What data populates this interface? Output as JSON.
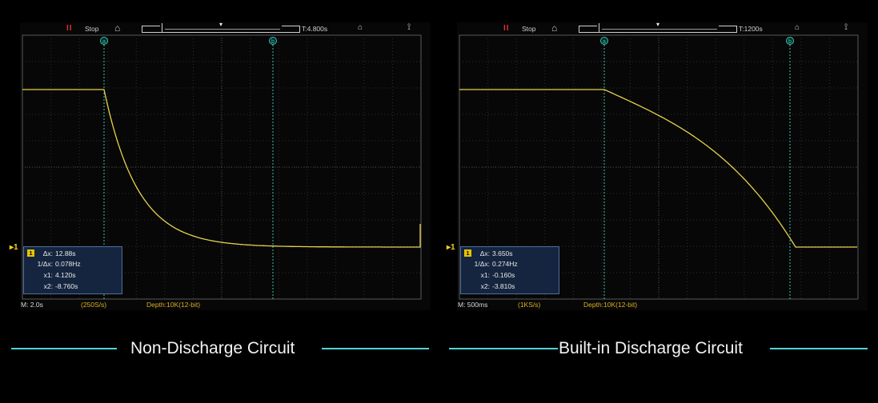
{
  "panels": [
    {
      "id": "left",
      "status": {
        "run_icon": "pause-icon",
        "run_glyph": "II",
        "text": "Stop"
      },
      "trigger_time": "T:4.800s",
      "cursor_labels": {
        "a": "a",
        "b": "b"
      },
      "channel_badge": "1",
      "trigger_marker": "1",
      "measurements": {
        "dx": "12.88s",
        "inv_dx": "0.078Hz",
        "x1": "4.120s",
        "x2": "-8.760s"
      },
      "timebase": "M: 2.0s",
      "sample_rate": "(250S/s)",
      "depth": "Depth:10K(12-bit)",
      "caption": "Non-Discharge Circuit"
    },
    {
      "id": "right",
      "status": {
        "run_icon": "pause-icon",
        "run_glyph": "II",
        "text": "Stop"
      },
      "trigger_time": "T:1200s",
      "cursor_labels": {
        "a": "a",
        "b": "b"
      },
      "channel_badge": "1",
      "trigger_marker": "1",
      "measurements": {
        "dx": "3.650s",
        "inv_dx": "0.274Hz",
        "x1": "-0.160s",
        "x2": "-3.810s"
      },
      "timebase": "M: 500ms",
      "sample_rate": "(1KS/s)",
      "depth": "Depth:10K(12-bit)",
      "caption": "Built-in Discharge Circuit"
    }
  ],
  "labels": {
    "dx": "Δx:",
    "inv_dx": "1/Δx:",
    "x1": "x1:",
    "x2": "x2:"
  },
  "colors": {
    "trace": "#e6d24a",
    "cursor": "#3fc0b0",
    "accent_line": "#4fd6d6",
    "stop_icon": "#e03030"
  }
}
